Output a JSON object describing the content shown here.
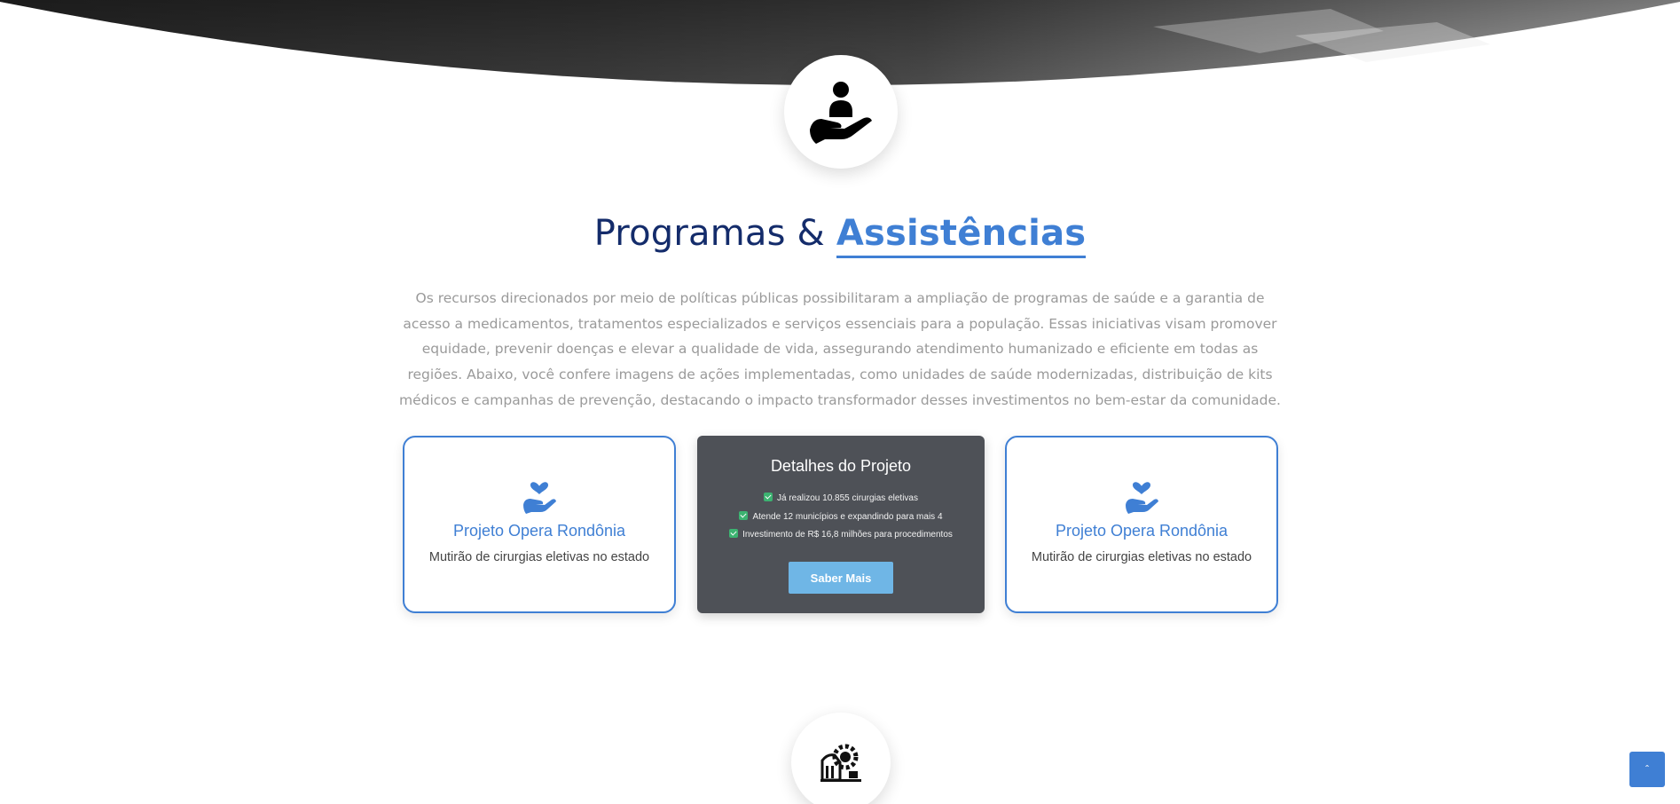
{
  "section": {
    "title_main": "Programas &",
    "title_accent": "Assistências",
    "intro": "Os recursos direcionados por meio de políticas públicas possibilitaram a ampliação de programas de saúde e a garantia de acesso a medicamentos, tratamentos especializados e serviços essenciais para a população. Essas iniciativas visam promover equidade, prevenir doenças e elevar a qualidade de vida, assegurando atendimento humanizado e eficiente em todas as regiões. Abaixo, você confere imagens de ações implementadas, como unidades de saúde modernizadas, distribuição de kits médicos e campanhas de prevenção, destacando o impacto transformador desses investimentos no bem-estar da comunidade."
  },
  "cards": [
    {
      "icon": "hand-holding-heart-icon",
      "title": "Projeto Opera Rondônia",
      "subtitle": "Mutirão de cirurgias eletivas no estado"
    },
    {
      "icon": "hand-holding-heart-icon",
      "title": "Projeto Opera Rondônia",
      "subtitle": "Mutirão de cirurgias eletivas no estado"
    }
  ],
  "details": {
    "title": "Detalhes do Projeto",
    "items": [
      "Já realizou 10.855 cirurgias eletivas",
      "Atende 12 municípios e expandindo para mais 4",
      "Investimento de R$ 16,8 milhões para procedimentos"
    ],
    "button_label": "Saber Mais"
  },
  "icons": {
    "top_badge": "person-in-hand-icon",
    "bottom_badge": "gear-building-icon",
    "back_to_top": "chevron-up-icon"
  },
  "colors": {
    "primary": "#3f7fd4",
    "title_dark": "#142c6b",
    "detail_bg": "#4e5157",
    "button": "#6fb6e6",
    "check": "#3cb371"
  },
  "back_to_top": {
    "label": "ˆ"
  }
}
